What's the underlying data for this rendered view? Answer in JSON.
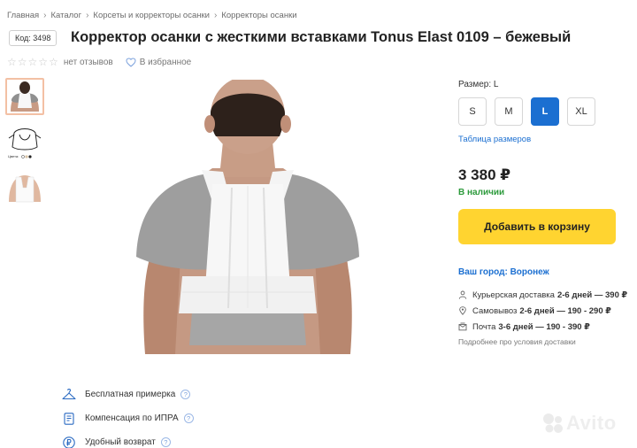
{
  "breadcrumbs": [
    "Главная",
    "Каталог",
    "Корсеты и корректоры осанки",
    "Корректоры осанки"
  ],
  "product": {
    "code": "Код: 3498",
    "title": "Корректор осанки с жесткими вставками Tonus Elast 0109 – бежевый",
    "reviews": "нет отзывов",
    "favorite": "В избранное",
    "rating_stars": 5
  },
  "size": {
    "label": "Размер: L",
    "options": [
      "S",
      "M",
      "L",
      "XL"
    ],
    "selected": "L",
    "table_link": "Таблица размеров"
  },
  "price": {
    "value": "3 380 ₽",
    "stock": "В наличии",
    "cart_button": "Добавить в корзину"
  },
  "delivery": {
    "city": "Ваш город: Воронеж",
    "rows": [
      {
        "icon": "person-icon",
        "label": "Курьерская доставка",
        "value": "2-6 дней — 390 ₽"
      },
      {
        "icon": "location-pin-icon",
        "label": "Самовывоз",
        "value": "2-6 дней — 190 - 290 ₽"
      },
      {
        "icon": "package-icon",
        "label": "Почта",
        "value": "3-6 дней — 190 - 390 ₽"
      }
    ],
    "more_link": "Подробнее про условия доставки"
  },
  "features": [
    {
      "icon": "hanger-icon",
      "label": "Бесплатная примерка"
    },
    {
      "icon": "document-icon",
      "label": "Компенсация по ИПРА"
    },
    {
      "icon": "ruble-icon",
      "label": "Удобный возврат"
    }
  ],
  "thumbnail_caption": "Цвета:",
  "watermark": "Avito",
  "colors": {
    "accent": "#1b6fd1",
    "cart": "#ffd430",
    "stock": "#2c9a3b",
    "thumb_border": "#f3c0a4"
  }
}
